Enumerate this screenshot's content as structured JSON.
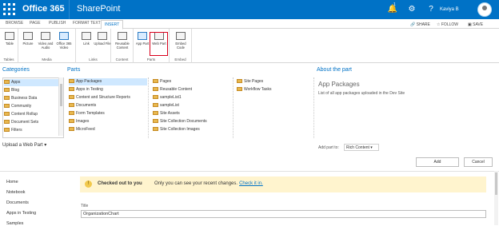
{
  "suite": {
    "brand": "Office 365",
    "app": "SharePoint",
    "notification_count": "1",
    "settings_icon": "⚙",
    "help_icon": "?",
    "user": "Kaviya B"
  },
  "tabs": [
    "BROWSE",
    "PAGE",
    "PUBLISH",
    "FORMAT TEXT",
    "INSERT"
  ],
  "actions": [
    "SHARE",
    "FOLLOW",
    "SAVE"
  ],
  "ribbon": {
    "groups": [
      "Tables",
      "Media",
      "Links",
      "Content",
      "Parts",
      "Embed"
    ],
    "commands": [
      "Table",
      "Picture",
      "Video and Audio",
      "Office 365 Video",
      "Link",
      "Upload File",
      "Reusable Content",
      "App Part",
      "Web Part",
      "Embed Code"
    ]
  },
  "panes": {
    "categories": "Categories",
    "parts": "Parts",
    "about": "About the part"
  },
  "categories": [
    "Apps",
    "Blog",
    "Business Data",
    "Community",
    "Content Rollup",
    "Document Sets",
    "Filters"
  ],
  "parts": {
    "col1": [
      "App Packages",
      "Apps in Testing",
      "Content and Structure Reports",
      "Documents",
      "Form Templates",
      "Images",
      "MicroFeed"
    ],
    "col2": [
      "Pages",
      "Reusable Content",
      "sampleList1",
      "sampleList",
      "Site Assets",
      "Site Collection Documents",
      "Site Collection Images"
    ],
    "col3": [
      "Site Pages",
      "Workflow Tasks"
    ]
  },
  "about": {
    "title": "App Packages",
    "description": "List of all app packages uploaded in the Dev Site",
    "add_part_label": "Add part to:",
    "add_part_value": "Rich Content"
  },
  "upload": "Upload a Web Part",
  "buttons": {
    "add": "Add",
    "cancel": "Cancel"
  },
  "left_nav": [
    "Home",
    "Notebook",
    "Documents",
    "Apps in Testing",
    "Samples"
  ],
  "notice": {
    "strong": "Checked out to you",
    "text": "Only you can see your recent changes.",
    "link": "Check it in."
  },
  "title_label": "Title",
  "title_value": "OrganizationChart"
}
